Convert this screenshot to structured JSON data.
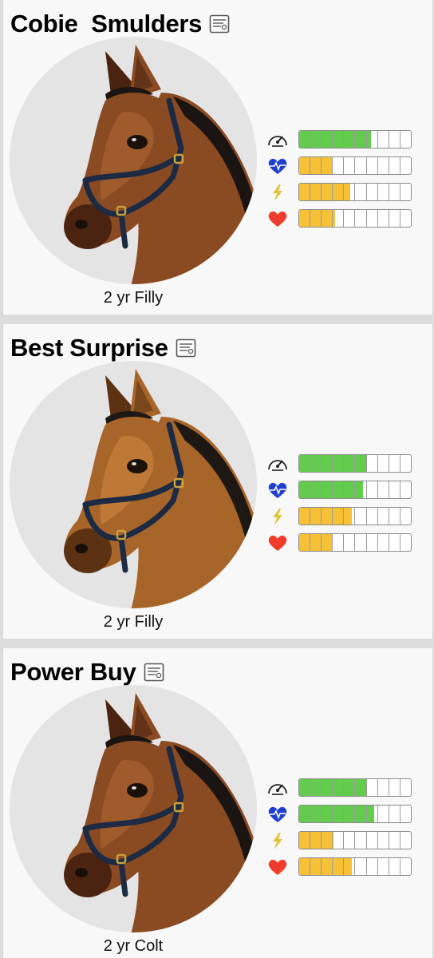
{
  "colors": {
    "green": "#62cd4c",
    "yellow": "#f7c137",
    "heart_blue": "#1f3fd1",
    "heart_red": "#f03c2a",
    "lightning": "#e2c43a"
  },
  "stat_icons": [
    "speedometer-icon",
    "heart-pulse-icon",
    "lightning-icon",
    "heart-icon"
  ],
  "horses": [
    {
      "name": "Cobie  Smulders",
      "age_label": "2 yr Filly",
      "coat": "bay",
      "stats": [
        {
          "icon": "speedometer-icon",
          "level": 0.64,
          "color": "green"
        },
        {
          "icon": "heart-pulse-icon",
          "level": 0.29,
          "color": "yellow"
        },
        {
          "icon": "lightning-icon",
          "level": 0.46,
          "color": "yellow"
        },
        {
          "icon": "heart-icon",
          "level": 0.32,
          "color": "yellow"
        }
      ]
    },
    {
      "name": "Best Surprise",
      "age_label": "2 yr Filly",
      "coat": "chestnut",
      "stats": [
        {
          "icon": "speedometer-icon",
          "level": 0.61,
          "color": "green"
        },
        {
          "icon": "heart-pulse-icon",
          "level": 0.57,
          "color": "green"
        },
        {
          "icon": "lightning-icon",
          "level": 0.47,
          "color": "yellow"
        },
        {
          "icon": "heart-icon",
          "level": 0.29,
          "color": "yellow"
        }
      ]
    },
    {
      "name": "Power Buy",
      "age_label": "2 yr Colt",
      "coat": "bay",
      "stats": [
        {
          "icon": "speedometer-icon",
          "level": 0.6,
          "color": "green"
        },
        {
          "icon": "heart-pulse-icon",
          "level": 0.67,
          "color": "green"
        },
        {
          "icon": "lightning-icon",
          "level": 0.31,
          "color": "yellow"
        },
        {
          "icon": "heart-icon",
          "level": 0.47,
          "color": "yellow"
        }
      ]
    }
  ]
}
